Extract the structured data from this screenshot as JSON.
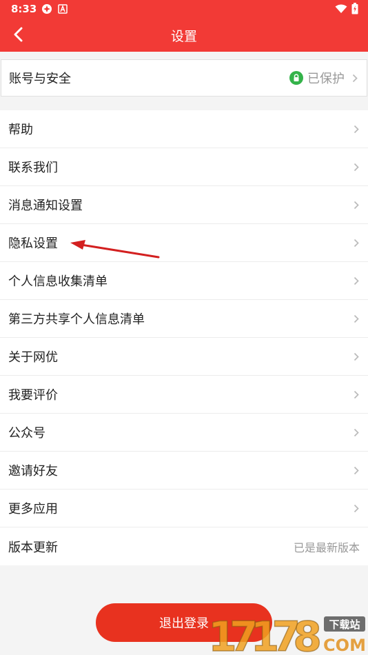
{
  "status_bar": {
    "time": "8:33"
  },
  "header": {
    "title": "设置"
  },
  "account": {
    "label": "账号与安全",
    "status": "已保护"
  },
  "items": [
    {
      "label": "帮助"
    },
    {
      "label": "联系我们"
    },
    {
      "label": "消息通知设置"
    },
    {
      "label": "隐私设置"
    },
    {
      "label": "个人信息收集清单"
    },
    {
      "label": "第三方共享个人信息清单"
    },
    {
      "label": "关于网优"
    },
    {
      "label": "我要评价"
    },
    {
      "label": "公众号"
    },
    {
      "label": "邀请好友"
    },
    {
      "label": "更多应用"
    }
  ],
  "version": {
    "label": "版本更新",
    "status": "已是最新版本"
  },
  "logout": {
    "label": "退出登录"
  },
  "watermark": {
    "number": "17178",
    "tag": "下载站",
    "domain": "COM"
  },
  "colors": {
    "header": "#f23a36",
    "button": "#e8321f",
    "lock": "#34b34a"
  }
}
